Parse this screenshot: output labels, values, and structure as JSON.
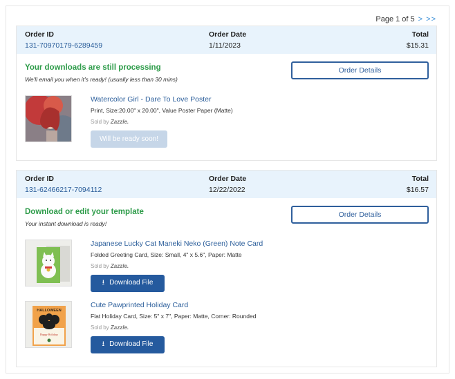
{
  "pagination": {
    "text": "Page 1 of 5",
    "nav": "> >>"
  },
  "orders": [
    {
      "header": {
        "id_label": "Order ID",
        "id_value": "131-70970179-6289459",
        "date_label": "Order Date",
        "date_value": "1/11/2023",
        "total_label": "Total",
        "total_value": "$15.31"
      },
      "status_title": "Your downloads are still processing",
      "status_sub": "We'll email you when it's ready! (usually less than 30 mins)",
      "details_label": "Order Details",
      "items": [
        {
          "title": "Watercolor Girl - Dare To Love Poster",
          "desc": "Print, Size:20.00\" x 20.00\", Value Poster Paper (Matte)",
          "sold_prefix": "Sold by",
          "sold_brand": "Zazzle.",
          "button": "Will be ready soon!"
        }
      ]
    },
    {
      "header": {
        "id_label": "Order ID",
        "id_value": "131-62466217-7094112",
        "date_label": "Order Date",
        "date_value": "12/22/2022",
        "total_label": "Total",
        "total_value": "$16.57"
      },
      "status_title": "Download or edit your template",
      "status_sub": "Your instant download is ready!",
      "details_label": "Order Details",
      "items": [
        {
          "title": "Japanese Lucky Cat Maneki Neko (Green) Note Card",
          "desc": "Folded Greeting Card, Size: Small, 4\" x 5.6\", Paper: Matte",
          "sold_prefix": "Sold by",
          "sold_brand": "Zazzle.",
          "button": "Download File"
        },
        {
          "title": "Cute Pawprinted Holiday Card",
          "desc": "Flat Holiday Card, Size: 5\" x 7\", Paper: Matte, Corner: Rounded",
          "sold_prefix": "Sold by",
          "sold_brand": "Zazzle.",
          "button": "Download File",
          "card_text": [
            "HALLOWEEN",
            "Happy Holidays"
          ]
        }
      ]
    }
  ],
  "icons": {
    "download": "download-icon"
  }
}
